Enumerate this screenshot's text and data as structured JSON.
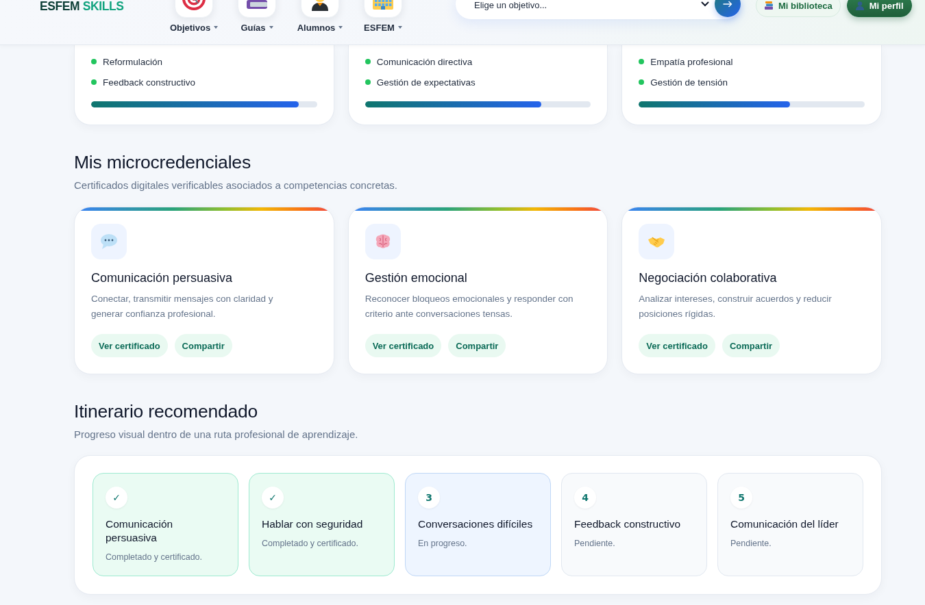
{
  "header": {
    "logo": {
      "primary": "ESFEM",
      "accent": "SKILLS"
    },
    "nav": [
      {
        "kind": "target",
        "label": "Objetivos"
      },
      {
        "kind": "books",
        "label": "Guías"
      },
      {
        "kind": "student",
        "label": "Alumnos"
      },
      {
        "kind": "building",
        "label": "ESFEM"
      }
    ],
    "goal_select": {
      "value": "Elige un objetivo..."
    },
    "actions": [
      {
        "kind": "library",
        "label": "Mi biblioteca"
      },
      {
        "kind": "profile",
        "label": "Mi perfil"
      }
    ]
  },
  "skill_cards": [
    {
      "skills": [
        "Reformulación",
        "Feedback constructivo"
      ],
      "level": 0.92
    },
    {
      "skills": [
        "Comunicación directiva",
        "Gestión de expectativas"
      ],
      "level": 0.78
    },
    {
      "skills": [
        "Empatía profesional",
        "Gestión de tensión"
      ],
      "level": 0.67
    }
  ],
  "microcredentials": {
    "title": "Mis microcredenciales",
    "subtitle": "Certificados digitales verificables asociados a competencias concretas.",
    "cards": [
      {
        "kind": "speech",
        "title": "Comunicación persuasiva",
        "description": "Conectar, transmitir mensajes con claridad y generar confianza profesional.",
        "actions": [
          "Ver certificado",
          "Compartir"
        ]
      },
      {
        "kind": "brain",
        "title": "Gestión emocional",
        "description": "Reconocer bloqueos emocionales y responder con criterio ante conversaciones tensas.",
        "actions": [
          "Ver certificado",
          "Compartir"
        ]
      },
      {
        "kind": "handshake",
        "title": "Negociación colaborativa",
        "description": "Analizar intereses, construir acuerdos y reducir posiciones rígidas.",
        "actions": [
          "Ver certificado",
          "Compartir"
        ]
      }
    ]
  },
  "itinerary": {
    "title": "Itinerario recomendado",
    "subtitle": "Progreso visual dentro de una ruta profesional de aprendizaje.",
    "steps": [
      {
        "kind": "done",
        "marker": "✓",
        "title": "Comunicación persuasiva",
        "status": "Completado y certificado."
      },
      {
        "kind": "done",
        "marker": "✓",
        "title": "Hablar con seguridad",
        "status": "Completado y certificado."
      },
      {
        "kind": "current",
        "marker": "3",
        "title": "Conversaciones difíciles",
        "status": "En progreso."
      },
      {
        "kind": "pending",
        "marker": "4",
        "title": "Feedback constructivo",
        "status": "Pendiente."
      },
      {
        "kind": "pending",
        "marker": "5",
        "title": "Comunicación del líder",
        "status": "Pendiente."
      }
    ]
  }
}
